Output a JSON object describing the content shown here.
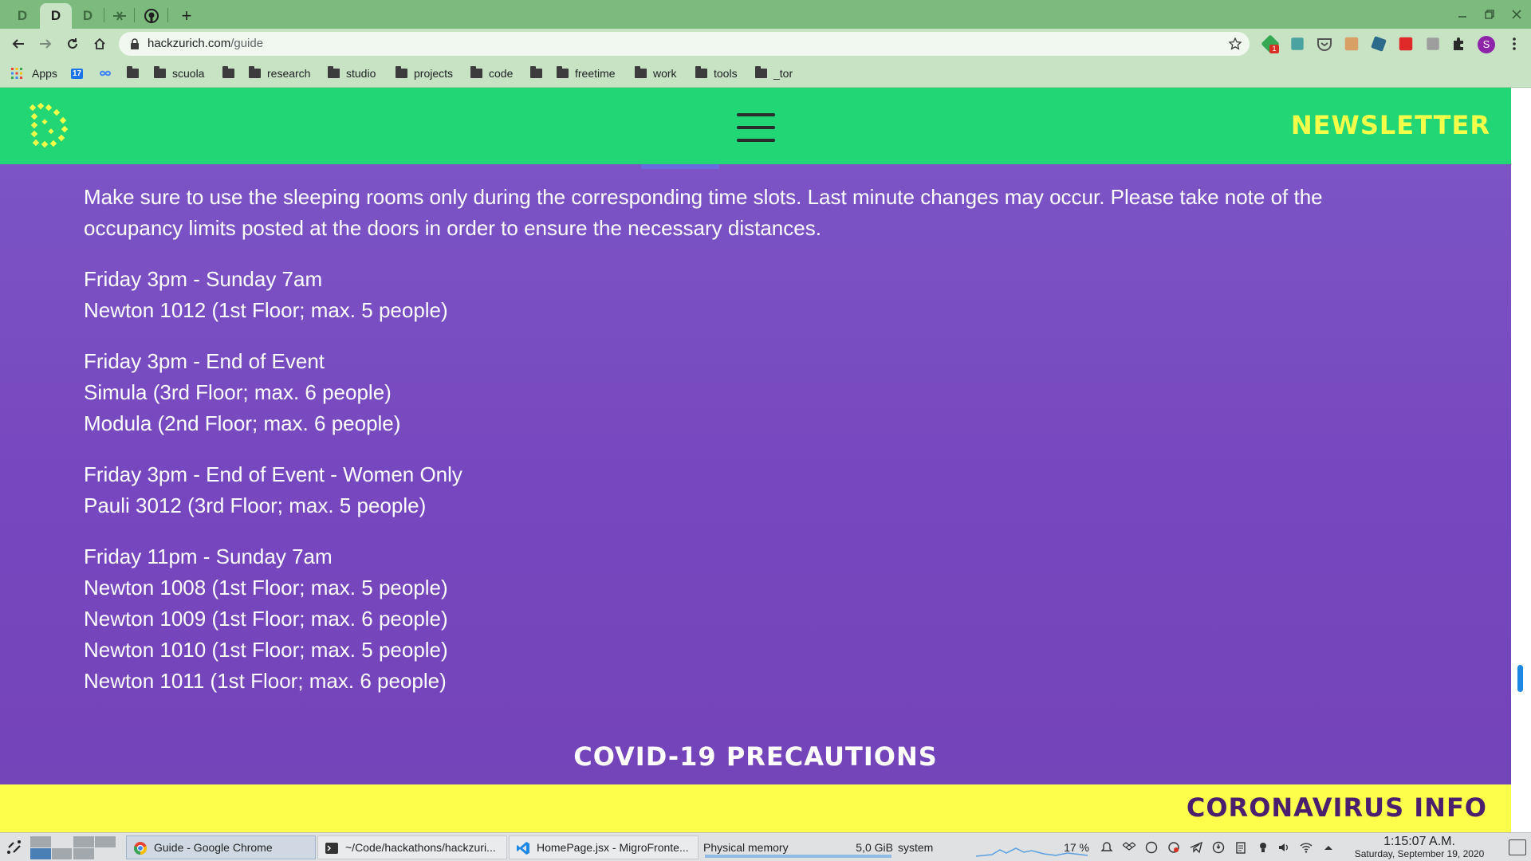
{
  "browser": {
    "tabs": [
      {
        "letter": "D",
        "active": false
      },
      {
        "letter": "D",
        "active": true
      },
      {
        "letter": "D",
        "active": false
      }
    ],
    "new_tab_symbol": "+",
    "url_host": "hackzurich.com",
    "url_path": "/guide",
    "profile_initial": "S",
    "extension_badge": "1",
    "bookmarks": {
      "apps_label": "Apps",
      "calendar_label": "17",
      "folders": [
        "scuola",
        "research",
        "studio",
        "projects",
        "code",
        "freetime",
        "work",
        "tools",
        "_tor"
      ]
    }
  },
  "site": {
    "nav": {
      "newsletter_label": "NEWSLETTER"
    },
    "intro": "Make sure to use the sleeping rooms only during the corresponding time slots. Last minute changes may occur. Please take note of the occupancy limits posted at the doors in order to ensure the necessary distances.",
    "schedule": [
      {
        "slot": "Friday 3pm - Sunday 7am",
        "rooms": [
          "Newton 1012 (1st Floor; max. 5 people)"
        ]
      },
      {
        "slot": "Friday 3pm - End of Event",
        "rooms": [
          "Simula (3rd Floor; max. 6 people)",
          "Modula (2nd Floor; max. 6 people)"
        ]
      },
      {
        "slot": "Friday 3pm - End of Event - Women Only",
        "rooms": [
          "Pauli 3012 (3rd Floor; max. 5 people)"
        ]
      },
      {
        "slot": "Friday 11pm - Sunday 7am",
        "rooms": [
          "Newton 1008 (1st Floor; max. 5 people)",
          "Newton 1009 (1st Floor; max. 6 people)",
          "Newton 1010 (1st Floor; max. 5 people)",
          "Newton 1011 (1st Floor; max. 6 people)"
        ]
      }
    ],
    "covid_title": "COVID-19 PRECAUTIONS",
    "corona_banner": "CORONAVIRUS INFO"
  },
  "taskbar": {
    "windows": [
      {
        "label": "Guide - Google Chrome",
        "active": true
      },
      {
        "label": "~/Code/hackathons/hackzuri...",
        "active": false
      },
      {
        "label": "HomePage.jsx - MigroFronte...",
        "active": false
      }
    ],
    "memory_label": "Physical memory",
    "memory_value": "5,0 GiB",
    "cpu_label": "system",
    "cpu_percent": "17 %",
    "time": "1:15:07 A.M.",
    "date": "Saturday, September 19, 2020"
  },
  "colors": {
    "tabstrip": "#7dba7e",
    "toolbar": "#c7e3c4",
    "site_nav": "#22d575",
    "newsletter": "#f4ff4a",
    "page_purple": "#7a4fc2",
    "corona_bar": "#fbff4b",
    "corona_text": "#4a1f6e"
  },
  "icons": [
    "back-icon",
    "forward-icon",
    "reload-icon",
    "home-icon",
    "lock-icon",
    "star-icon",
    "puzzle-icon",
    "kebab-menu-icon",
    "folder-icon",
    "apps-grid-icon",
    "hamburger-icon",
    "chrome-icon",
    "terminal-icon",
    "vscode-icon"
  ]
}
